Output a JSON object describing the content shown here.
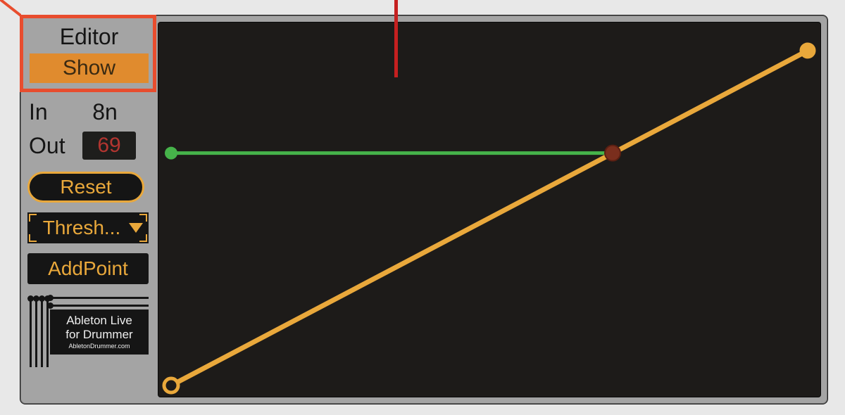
{
  "annotations": {
    "callout_box": true
  },
  "sidebar": {
    "editor_label": "Editor",
    "show_label": "Show",
    "in_label": "In",
    "in_value": "8n",
    "out_label": "Out",
    "out_value": "69",
    "reset_label": "Reset",
    "dropdown_label": "Thresh...",
    "addpoint_label": "AddPoint",
    "logo": {
      "line1": "Ableton Live",
      "line2": "for Drummer",
      "line3": "AbletonDrummer.com"
    }
  },
  "colors": {
    "accent_orange": "#e9a83b",
    "button_orange": "#e08b2e",
    "red_value": "#b23530",
    "green_line": "#46b34a",
    "intersection": "#7a2e1d"
  },
  "chart_data": {
    "type": "line",
    "title": "",
    "xlabel": "",
    "ylabel": "",
    "xlim": [
      0,
      127
    ],
    "ylim": [
      0,
      127
    ],
    "series": [
      {
        "name": "curve",
        "color": "#e9a83b",
        "x": [
          0,
          127
        ],
        "y": [
          0,
          127
        ]
      },
      {
        "name": "marker-horizontal",
        "color": "#46b34a",
        "x": [
          0,
          88
        ],
        "y": [
          88,
          88
        ]
      }
    ],
    "points": [
      {
        "name": "curve-start",
        "x": 0,
        "y": 0,
        "color": "#e9a83b",
        "fill": "#1d1b19"
      },
      {
        "name": "curve-end",
        "x": 127,
        "y": 127,
        "color": "#e9a83b",
        "fill": "#e9a83b"
      },
      {
        "name": "marker-start",
        "x": 0,
        "y": 88,
        "color": "#46b34a",
        "fill": "#46b34a"
      },
      {
        "name": "intersection",
        "x": 88,
        "y": 88,
        "color": "#7a2e1d",
        "fill": "#7a2e1d"
      }
    ]
  }
}
